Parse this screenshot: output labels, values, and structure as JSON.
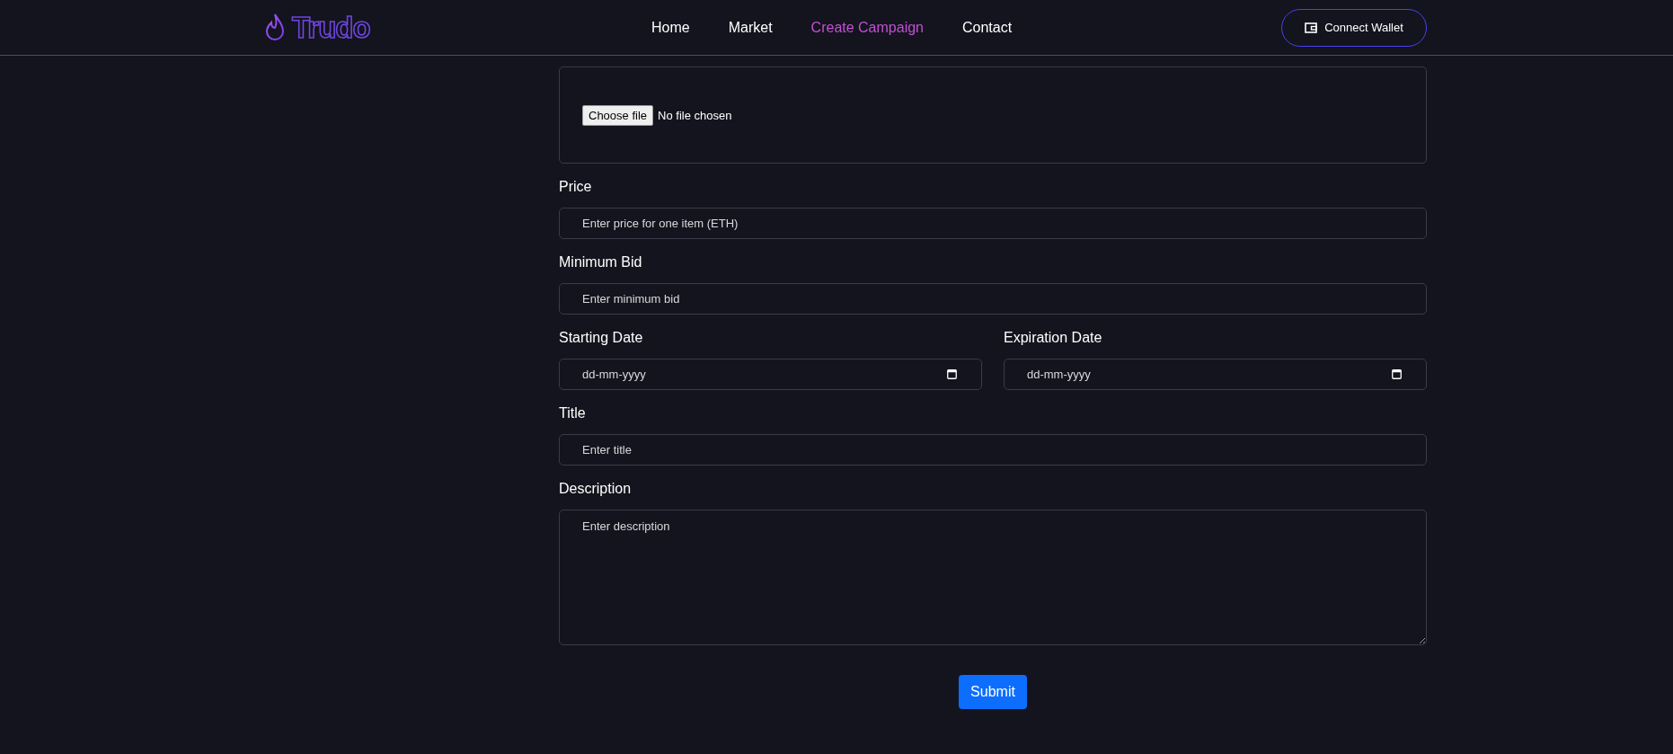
{
  "header": {
    "logo": "Trudo",
    "nav": [
      {
        "label": "Home",
        "selected": false
      },
      {
        "label": "Market",
        "selected": false
      },
      {
        "label": "Create Campaign",
        "selected": true
      },
      {
        "label": "Contact",
        "selected": false
      }
    ],
    "connect_button": "Connect Wallet"
  },
  "form": {
    "file_upload": {
      "button": "Choose file",
      "status": "No file chosen"
    },
    "rows": [
      [
        {
          "label": "Price",
          "kind": "text",
          "placeholder": "Enter price for one item (ETH)"
        }
      ],
      [
        {
          "label": "Minimum Bid",
          "kind": "text",
          "placeholder": "Enter minimum bid"
        }
      ],
      [
        {
          "label": "Starting Date",
          "kind": "date",
          "placeholder": "dd-mm-yyyy"
        },
        {
          "label": "Expiration Date",
          "kind": "date",
          "placeholder": "dd-mm-yyyy"
        }
      ],
      [
        {
          "label": "Title",
          "kind": "text",
          "placeholder": "Enter title"
        }
      ],
      [
        {
          "label": "Description",
          "kind": "textarea",
          "placeholder": "Enter description"
        }
      ]
    ],
    "submit": "Submit"
  }
}
